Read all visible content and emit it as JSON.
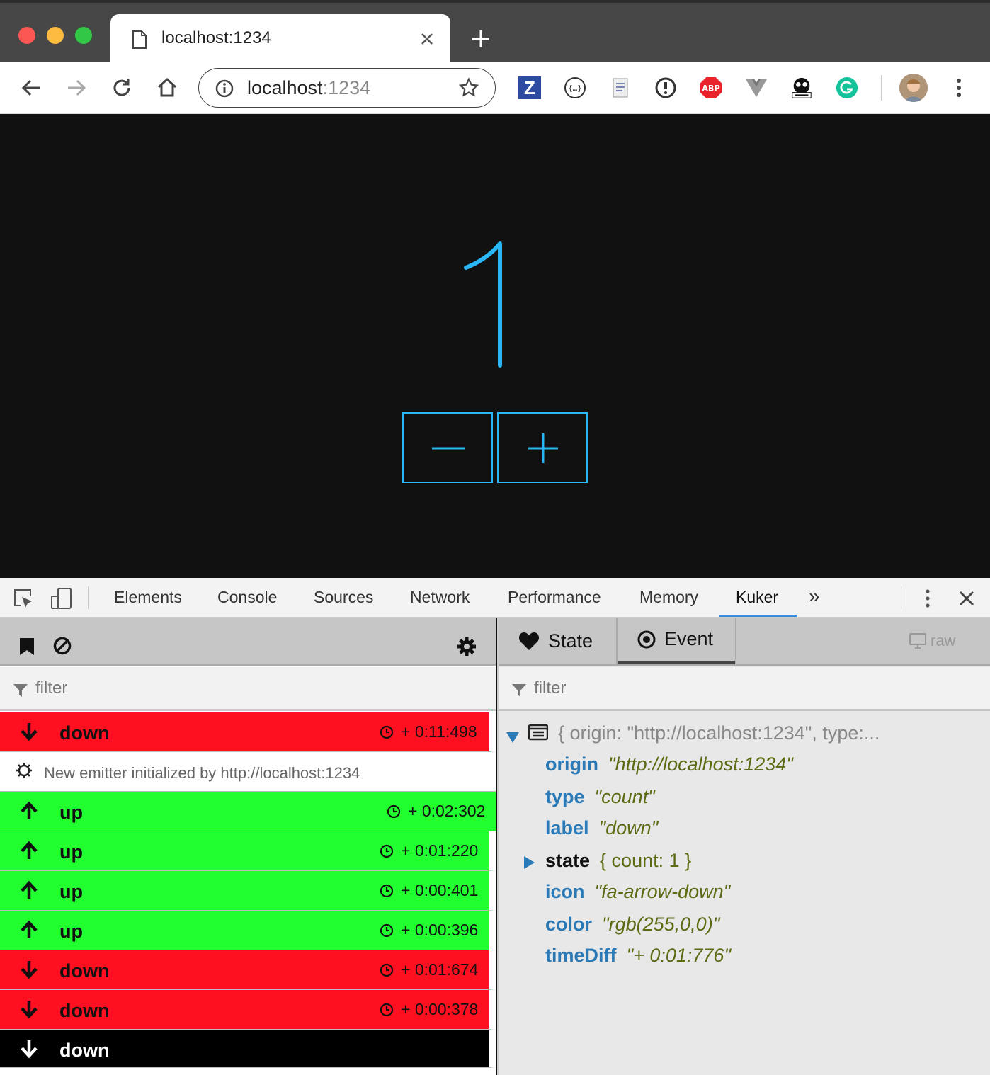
{
  "browser": {
    "tab_title": "localhost:1234",
    "url_host": "localhost",
    "url_port": ":1234",
    "extensions": [
      "zotero-icon",
      "json-viewer-icon",
      "page-icon",
      "info-icon",
      "adblock-icon",
      "vue-devtools-icon",
      "kuker-icon",
      "grammarly-icon"
    ],
    "adblock_label": "ABP",
    "zotero_label": "Z"
  },
  "app": {
    "count_value": "1",
    "accent": "#29b6f6"
  },
  "devtools": {
    "tabs": [
      "Elements",
      "Console",
      "Sources",
      "Network",
      "Performance",
      "Memory",
      "Kuker"
    ],
    "more": "»",
    "active_tab": "Kuker"
  },
  "kuker": {
    "left_filter_placeholder": "filter",
    "right_filter_placeholder": "filter",
    "events": [
      {
        "label": "down",
        "time": "+ 0:11:498",
        "dir": "down",
        "color": "#ff1020"
      },
      {
        "label": "New emitter initialized by http://localhost:1234",
        "time": "",
        "dir": "info",
        "color": "#ffffff"
      },
      {
        "label": "up",
        "time": "+ 0:02:302",
        "dir": "up",
        "color": "#22ff30"
      },
      {
        "label": "up",
        "time": "+ 0:01:220",
        "dir": "up",
        "color": "#22ff30"
      },
      {
        "label": "up",
        "time": "+ 0:00:401",
        "dir": "up",
        "color": "#22ff30"
      },
      {
        "label": "up",
        "time": "+ 0:00:396",
        "dir": "up",
        "color": "#22ff30"
      },
      {
        "label": "down",
        "time": "+ 0:01:674",
        "dir": "down",
        "color": "#ff1020"
      },
      {
        "label": "down",
        "time": "+ 0:00:378",
        "dir": "down",
        "color": "#ff1020"
      },
      {
        "label": "down",
        "time": "",
        "dir": "down-white",
        "color": "#000000"
      }
    ],
    "state_tab": "State",
    "event_tab": "Event",
    "raw_label": "raw",
    "summary": "{ origin: \"http://localhost:1234\", type:...",
    "fields": [
      {
        "key": "origin",
        "value": "\"http://localhost:1234\""
      },
      {
        "key": "type",
        "value": "\"count\""
      },
      {
        "key": "label",
        "value": "\"down\""
      },
      {
        "key": "state",
        "value": "{ count: 1 }"
      },
      {
        "key": "icon",
        "value": "\"fa-arrow-down\""
      },
      {
        "key": "color",
        "value": "\"rgb(255,0,0)\""
      },
      {
        "key": "timeDiff",
        "value": "\"+ 0:01:776\""
      }
    ]
  }
}
